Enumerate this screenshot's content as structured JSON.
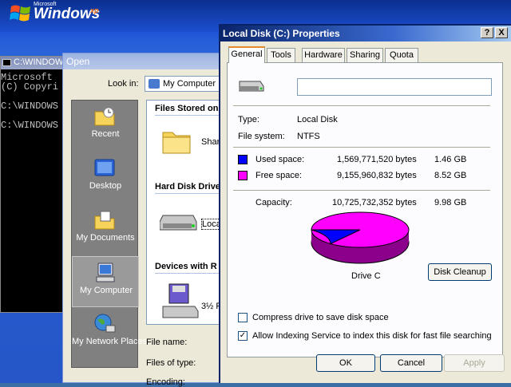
{
  "xp_banner": {
    "microsoft": "Microsoft",
    "windows": "Windows",
    "xp": "xp"
  },
  "cmd": {
    "title": "C:\\WINDOW",
    "lines": [
      "Microsoft",
      "(C) Copyri",
      "C:\\WINDOWS",
      "C:\\WINDOWS"
    ]
  },
  "open_dialog": {
    "title": "Open",
    "look_in_label": "Look in:",
    "look_in_value": "My Computer",
    "places": [
      "Recent",
      "Desktop",
      "My Documents",
      "My Computer",
      "My Network Places"
    ],
    "groups": [
      "Files Stored on",
      "Hard Disk Drive",
      "Devices with R"
    ],
    "items": [
      "Shar",
      "Loca",
      "3½ F"
    ],
    "file_name_label": "File name:",
    "files_of_type_label": "Files of type:",
    "encoding_label": "Encoding:"
  },
  "props": {
    "title": "Local Disk (C:) Properties",
    "help_btn": "?",
    "close_btn": "X",
    "tabs": [
      "General",
      "Tools",
      "Hardware",
      "Sharing",
      "Quota"
    ],
    "name_value": "",
    "type_label": "Type:",
    "type_value": "Local Disk",
    "fs_label": "File system:",
    "fs_value": "NTFS",
    "used_label": "Used space:",
    "used_bytes": "1,569,771,520 bytes",
    "used_gb": "1.46 GB",
    "free_label": "Free space:",
    "free_bytes": "9,155,960,832 bytes",
    "free_gb": "8.52 GB",
    "cap_label": "Capacity:",
    "cap_bytes": "10,725,732,352 bytes",
    "cap_gb": "9.98 GB",
    "drive_label": "Drive C",
    "cleanup_btn": "Disk Cleanup",
    "compress_label": "Compress drive to save disk space",
    "compress_checked": false,
    "index_label": "Allow Indexing Service to index this disk for fast file searching",
    "index_checked": true,
    "ok_btn": "OK",
    "cancel_btn": "Cancel",
    "apply_btn": "Apply",
    "used_fraction": 0.1464,
    "used_color": "#0000ff",
    "free_color": "#ff00ff"
  }
}
